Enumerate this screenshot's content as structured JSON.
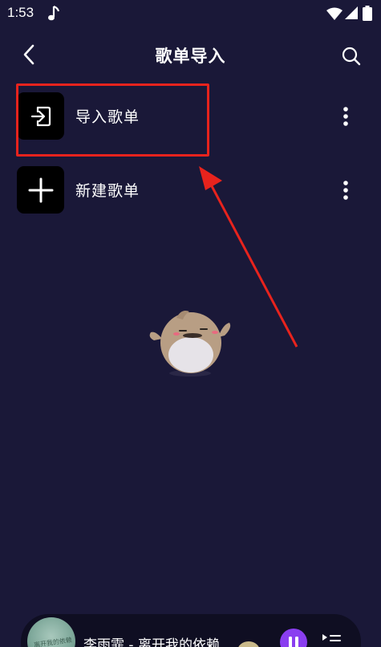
{
  "status_bar": {
    "time": "1:53",
    "icons": [
      "music-note-icon",
      "wifi-icon",
      "signal-icon",
      "battery-icon"
    ]
  },
  "header": {
    "title": "歌单导入",
    "back_icon": "chevron-left-icon",
    "search_icon": "search-icon"
  },
  "list": {
    "items": [
      {
        "label": "导入歌单",
        "icon": "import-icon",
        "more_icon": "more-vertical-icon"
      },
      {
        "label": "新建歌单",
        "icon": "plus-icon",
        "more_icon": "more-vertical-icon"
      }
    ]
  },
  "annotation": {
    "highlight_color": "#e8231d"
  },
  "mini_player": {
    "cover_text": "离开我的依赖",
    "song": "李雨霏 - 离开我的依赖",
    "play_state": "playing",
    "pause_color": "#8a3ef0"
  },
  "colors": {
    "background": "#1a1838",
    "icon_tile": "#000000",
    "accent": "#8a3ef0"
  }
}
